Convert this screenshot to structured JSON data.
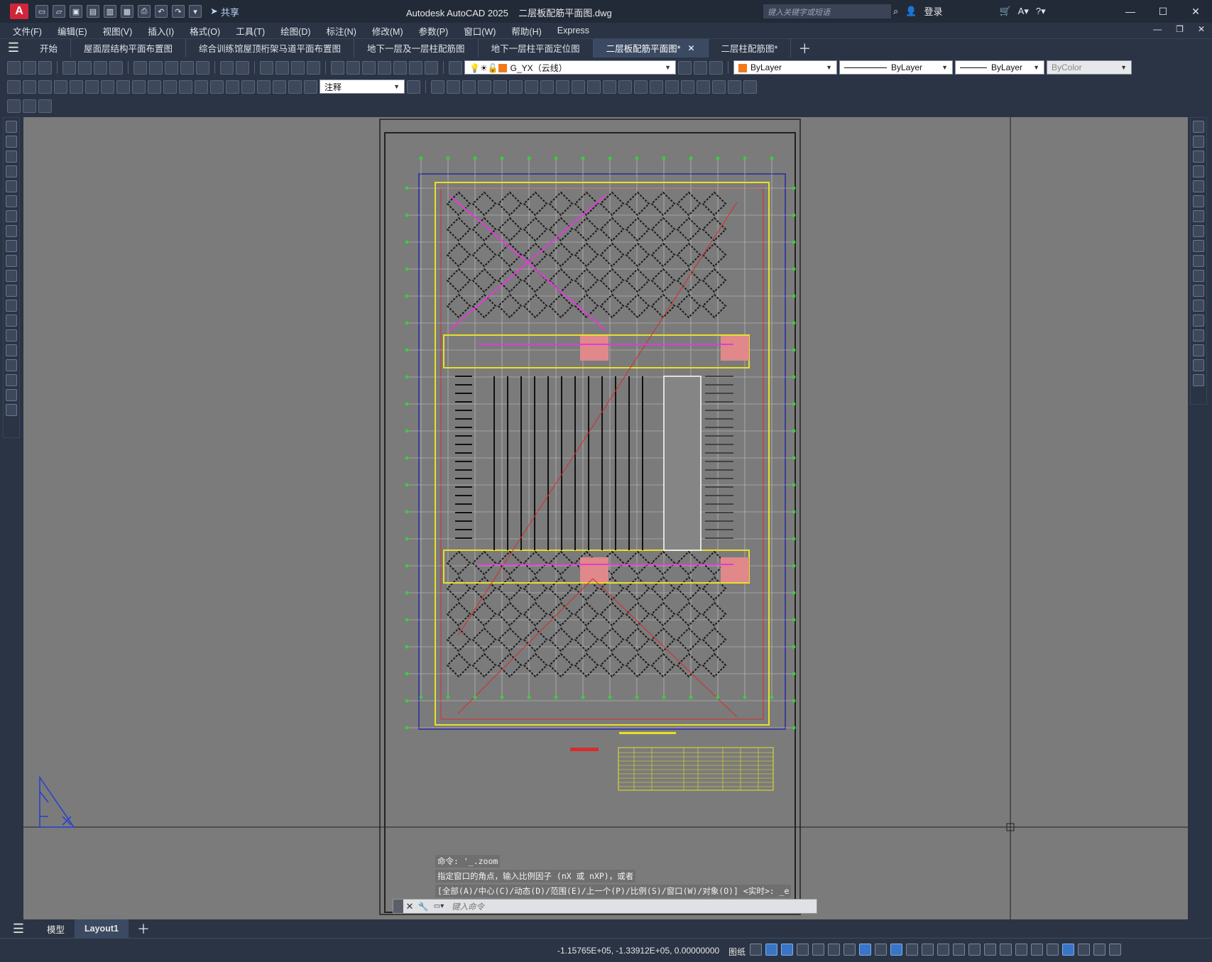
{
  "titlebar": {
    "app_name": "Autodesk AutoCAD 2025",
    "file_name": "二层板配筋平面图.dwg",
    "share_label": "共享",
    "search_placeholder": "键入关键字或短语",
    "login_label": "登录"
  },
  "menu": {
    "items": [
      "文件(F)",
      "编辑(E)",
      "视图(V)",
      "插入(I)",
      "格式(O)",
      "工具(T)",
      "绘图(D)",
      "标注(N)",
      "修改(M)",
      "参数(P)",
      "窗口(W)",
      "帮助(H)",
      "Express"
    ]
  },
  "tabs": [
    {
      "label": "开始"
    },
    {
      "label": "屋面层结构平面布置图"
    },
    {
      "label": "综合训练馆屋顶桁架马道平面布置图"
    },
    {
      "label": "地下一层及一层柱配筋图"
    },
    {
      "label": "地下一层柱平面定位图"
    },
    {
      "label": "二层板配筋平面图*",
      "active": true
    },
    {
      "label": "二层柱配筋图*"
    }
  ],
  "toolbar": {
    "layer_name": "G_YX（云线）",
    "color": "ByLayer",
    "linetype": "ByLayer",
    "lineweight": "ByLayer",
    "plotstyle": "ByColor",
    "annotation_style": "注释",
    "layer_color": "#f07a1a"
  },
  "command": {
    "history": [
      "命令: '_.zoom",
      "指定窗口的角点，输入比例因子 (nX 或 nXP)，或者",
      "[全部(A)/中心(C)/动态(D)/范围(E)/上一个(P)/比例(S)/窗口(W)/对象(O)] <实时>: _e"
    ],
    "placeholder": "键入命令"
  },
  "layout_tabs": {
    "model": "模型",
    "layout1": "Layout1"
  },
  "status": {
    "coordinates": "-1.15765E+05, -1.33912E+05, 0.00000000",
    "space": "图纸"
  }
}
